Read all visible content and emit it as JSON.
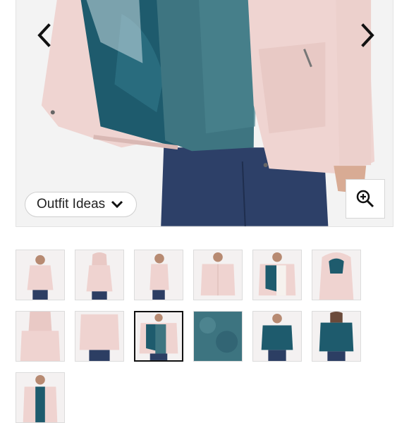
{
  "gallery": {
    "outfit_button_label": "Outfit Ideas",
    "prev_icon": "chevron-left-icon",
    "next_icon": "chevron-right-icon",
    "zoom_icon": "zoom-in-icon",
    "selected_index": 8,
    "colors": {
      "jacket_pink": "#efd3d0",
      "lining_teal": "#1d5a6c",
      "fleece_teal": "#3d7480",
      "denim": "#2c3e63"
    }
  }
}
